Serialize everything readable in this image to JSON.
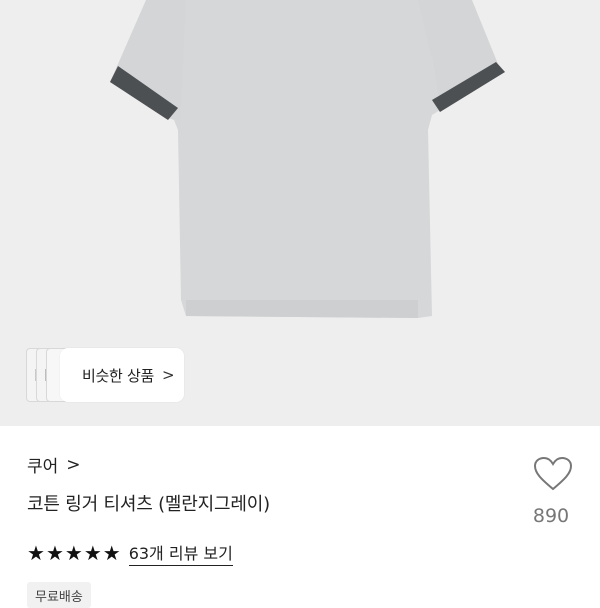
{
  "similar": {
    "label": "비슷한 상품",
    "chevron": ">"
  },
  "brand": {
    "name": "쿠어",
    "chevron": ">"
  },
  "product": {
    "title": "코튼 링거 티셔츠 (멜란지그레이)"
  },
  "like": {
    "icon": "heart-outline-icon",
    "count": "890"
  },
  "rating": {
    "stars": 5,
    "review_link": "63개 리뷰 보기"
  },
  "badges": {
    "shipping": "무료배송"
  },
  "colors": {
    "shirt": "#d5d7d8",
    "trim": "#4d5053",
    "hero_bg": "#eeeeee"
  }
}
